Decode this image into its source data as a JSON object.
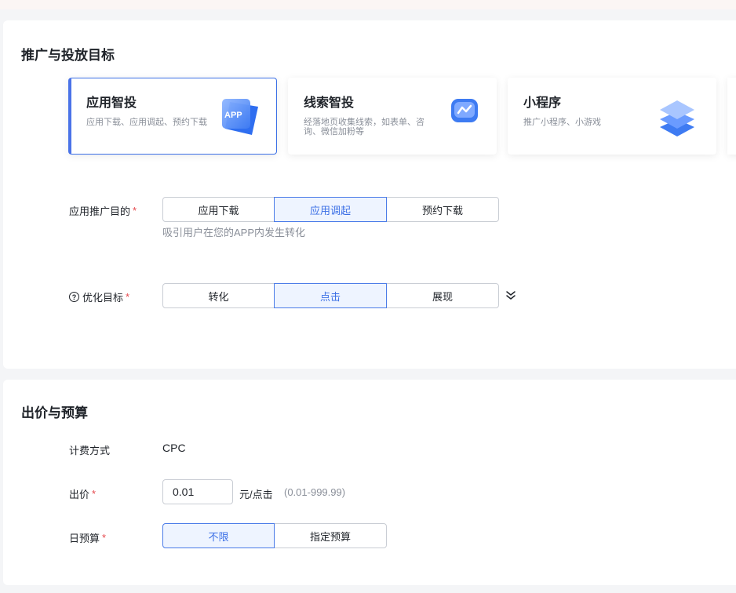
{
  "targeting": {
    "title": "推广与投放目标",
    "goals": [
      {
        "name": "应用智投",
        "desc": "应用下载、应用调起、预约下载",
        "icon": "app-icon",
        "icon_text": "APP"
      },
      {
        "name": "线索智投",
        "desc": "经落地页收集线索，如表单、咨询、微信加粉等",
        "icon": "chat-bubble-icon"
      },
      {
        "name": "小程序",
        "desc": "推广小程序、小游戏",
        "icon": "layers-icon"
      }
    ],
    "purpose": {
      "label": "应用推广目的",
      "required": "*",
      "options": [
        "应用下载",
        "应用调起",
        "预约下载"
      ],
      "selected": "应用调起",
      "hint": "吸引用户在您的APP内发生转化"
    },
    "optimize": {
      "label": "优化目标",
      "required": "*",
      "help_icon": "question-circle-icon",
      "options": [
        "转化",
        "点击",
        "展现"
      ],
      "selected": "点击",
      "expand_icon": "double-chevron-down-icon"
    }
  },
  "bidding": {
    "title": "出价与预算",
    "billing": {
      "label": "计费方式",
      "value": "CPC"
    },
    "bid": {
      "label": "出价",
      "required": "*",
      "value": "0.01",
      "unit": "元/点击",
      "range": "(0.01-999.99)"
    },
    "budget": {
      "label": "日预算",
      "required": "*",
      "options": [
        "不限",
        "指定预算"
      ],
      "selected": "不限"
    }
  },
  "colors": {
    "accent": "#3b6fe6",
    "active_bg": "#eef4ff",
    "required": "#e5484d"
  }
}
